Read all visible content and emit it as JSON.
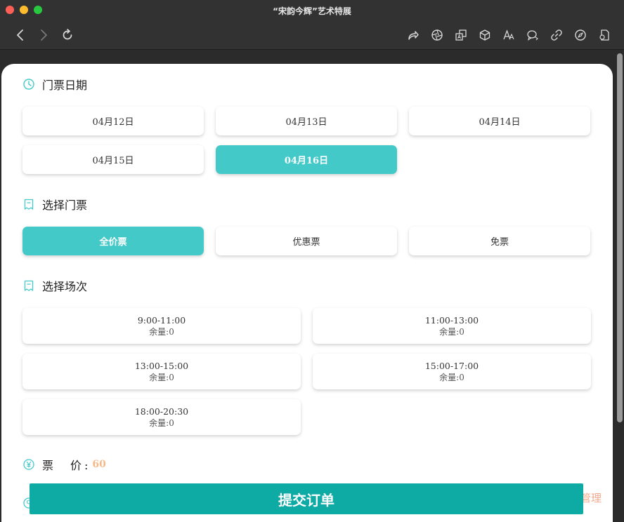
{
  "window": {
    "title": "“宋韵今辉”艺术特展"
  },
  "icons": {
    "back": "chevron-left-icon",
    "forward": "chevron-right-icon",
    "reload": "reload-icon",
    "toolbar": [
      "share-icon",
      "aperture-icon",
      "translate-icon",
      "cube-icon",
      "font-icon",
      "chat-icon",
      "link-icon",
      "compass-icon",
      "document-icon"
    ]
  },
  "colors": {
    "accent": "#44c9c9",
    "submit": "#0eaaa4",
    "price": "#f5b98a"
  },
  "sections": {
    "date": {
      "title": "门票日期"
    },
    "ticket": {
      "title": "选择门票"
    },
    "session": {
      "title": "选择场次"
    }
  },
  "dates": [
    {
      "label": "04月12日",
      "selected": false
    },
    {
      "label": "04月13日",
      "selected": false
    },
    {
      "label": "04月14日",
      "selected": false
    },
    {
      "label": "04月15日",
      "selected": false
    },
    {
      "label": "04月16日",
      "selected": true
    }
  ],
  "tickets": [
    {
      "label": "全价票",
      "selected": true
    },
    {
      "label": "优惠票",
      "selected": false
    },
    {
      "label": "免票",
      "selected": false
    }
  ],
  "sessions": [
    {
      "time": "9:00-11:00",
      "remaining": "余量:0"
    },
    {
      "time": "11:00-13:00",
      "remaining": "余量:0"
    },
    {
      "time": "13:00-15:00",
      "remaining": "余量:0"
    },
    {
      "time": "15:00-17:00",
      "remaining": "余量:0"
    },
    {
      "time": "18:00-20:30",
      "remaining": "余量:0"
    }
  ],
  "price": {
    "label": "票　价:",
    "value": "60"
  },
  "manage_text": "管理",
  "submit_label": "提交订单"
}
